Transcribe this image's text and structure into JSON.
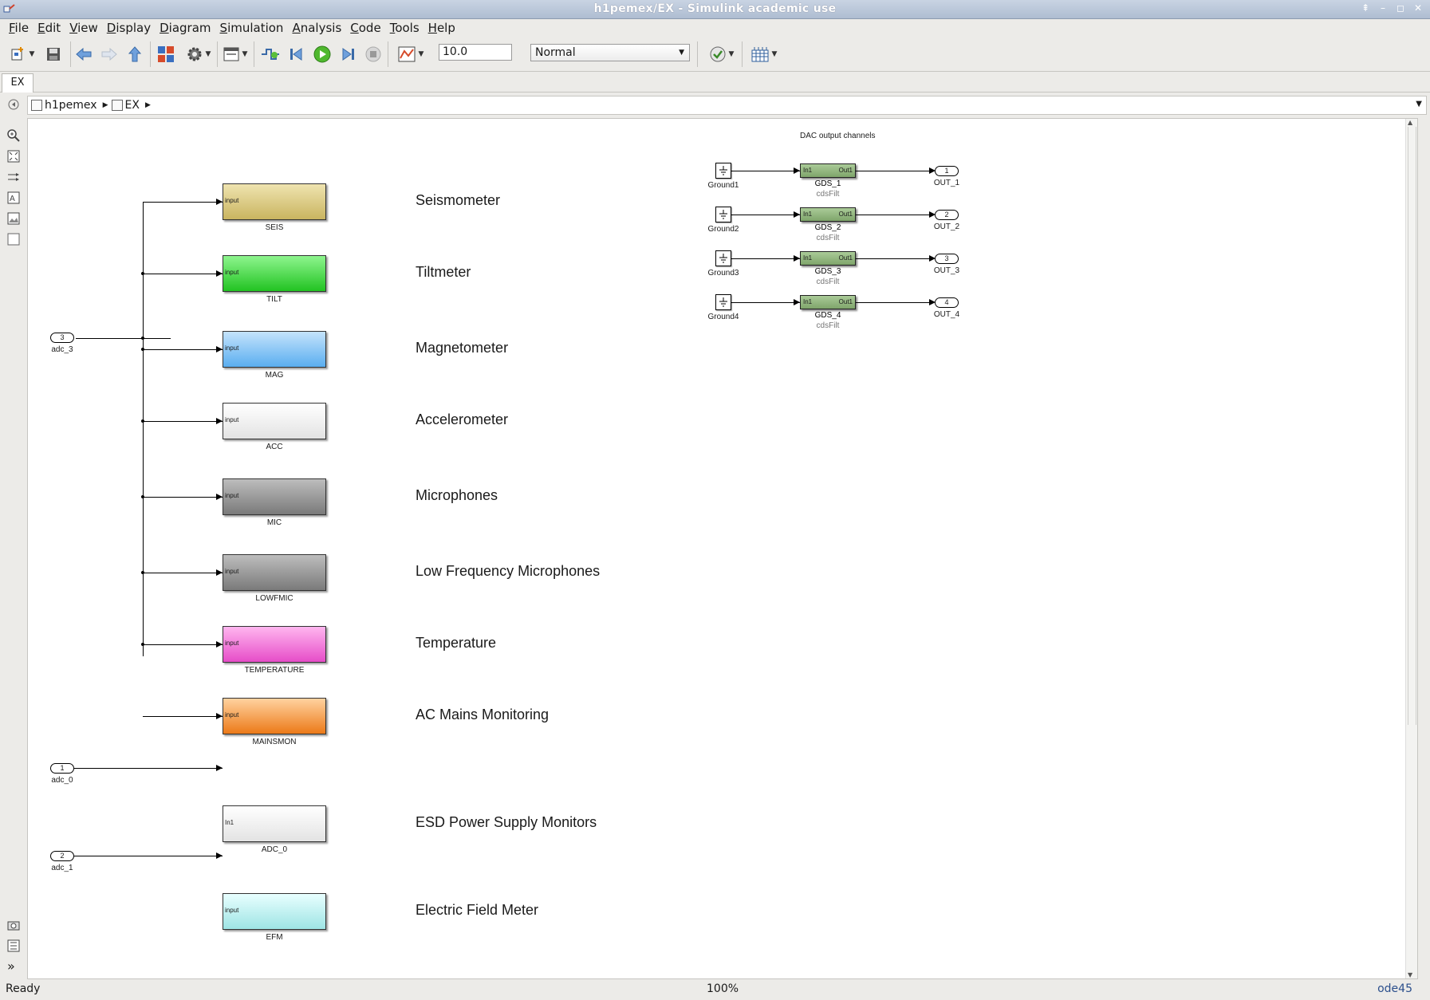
{
  "window": {
    "title": "h1pemex/EX - Simulink academic use"
  },
  "menu": [
    "File",
    "Edit",
    "View",
    "Display",
    "Diagram",
    "Simulation",
    "Analysis",
    "Code",
    "Tools",
    "Help"
  ],
  "toolbar": {
    "stop_time": "10.0",
    "sim_mode": "Normal"
  },
  "tab": {
    "label": "EX"
  },
  "breadcrumb": {
    "root": "h1pemex",
    "child": "EX"
  },
  "canvas": {
    "dac_title": "DAC output channels",
    "blocks": [
      {
        "name": "SEIS",
        "desc": "Seismometer",
        "port": "input",
        "color_top": "#efe4b0",
        "color_bot": "#c9b45f"
      },
      {
        "name": "TILT",
        "desc": "Tiltmeter",
        "port": "input",
        "color_top": "#8ef58e",
        "color_bot": "#22c322"
      },
      {
        "name": "MAG",
        "desc": "Magnetometer",
        "port": "input",
        "color_top": "#c4e3fb",
        "color_bot": "#5aaef0"
      },
      {
        "name": "ACC",
        "desc": "Accelerometer",
        "port": "input",
        "color_top": "#ffffff",
        "color_bot": "#e3e3e3"
      },
      {
        "name": "MIC",
        "desc": "Microphones",
        "port": "input",
        "color_top": "#bdbdbd",
        "color_bot": "#7a7a7a"
      },
      {
        "name": "LOWFMIC",
        "desc": "Low Frequency Microphones",
        "port": "input",
        "color_top": "#bdbdbd",
        "color_bot": "#7a7a7a"
      },
      {
        "name": "TEMPERATURE",
        "desc": "Temperature",
        "port": "input",
        "color_top": "#ffb6ef",
        "color_bot": "#e64dc8"
      },
      {
        "name": "MAINSMON",
        "desc": "AC Mains Monitoring",
        "port": "input",
        "color_top": "#ffd2a0",
        "color_bot": "#ec7a18"
      },
      {
        "name": "ADC_0",
        "desc": "ESD Power Supply Monitors",
        "port": "In1",
        "color_top": "#ffffff",
        "color_bot": "#e3e3e3"
      },
      {
        "name": "EFM",
        "desc": "Electric Field Meter",
        "port": "input",
        "color_top": "#e8ffff",
        "color_bot": "#9ee4e4"
      }
    ],
    "inports": [
      {
        "num": "3",
        "label": "adc_3"
      },
      {
        "num": "1",
        "label": "adc_0"
      },
      {
        "num": "2",
        "label": "adc_1"
      }
    ],
    "dac": [
      {
        "ground": "Ground1",
        "gds": "GDS_1",
        "sub": "cdsFilt",
        "in": "In1",
        "out": "Out1",
        "outnum": "1",
        "outlabel": "OUT_1"
      },
      {
        "ground": "Ground2",
        "gds": "GDS_2",
        "sub": "cdsFilt",
        "in": "In1",
        "out": "Out1",
        "outnum": "2",
        "outlabel": "OUT_2"
      },
      {
        "ground": "Ground3",
        "gds": "GDS_3",
        "sub": "cdsFilt",
        "in": "In1",
        "out": "Out1",
        "outnum": "3",
        "outlabel": "OUT_3"
      },
      {
        "ground": "Ground4",
        "gds": "GDS_4",
        "sub": "cdsFilt",
        "in": "In1",
        "out": "Out1",
        "outnum": "4",
        "outlabel": "OUT_4"
      }
    ]
  },
  "status": {
    "left": "Ready",
    "zoom": "100%",
    "solver": "ode45"
  }
}
